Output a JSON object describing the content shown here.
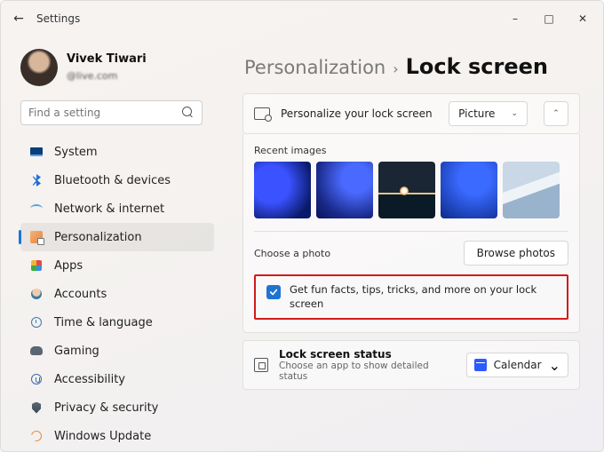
{
  "window": {
    "app_title": "Settings"
  },
  "user": {
    "name": "Vivek Tiwari",
    "email_suffix": "@live.com"
  },
  "search": {
    "placeholder": "Find a setting"
  },
  "nav": [
    {
      "label": "System"
    },
    {
      "label": "Bluetooth & devices"
    },
    {
      "label": "Network & internet"
    },
    {
      "label": "Personalization"
    },
    {
      "label": "Apps"
    },
    {
      "label": "Accounts"
    },
    {
      "label": "Time & language"
    },
    {
      "label": "Gaming"
    },
    {
      "label": "Accessibility"
    },
    {
      "label": "Privacy & security"
    },
    {
      "label": "Windows Update"
    }
  ],
  "breadcrumb": {
    "parent": "Personalization",
    "current": "Lock screen"
  },
  "personalize_row": {
    "icon": "monitor-lock-icon",
    "label": "Personalize your lock screen",
    "select_value": "Picture"
  },
  "recent": {
    "title": "Recent images",
    "count": 5
  },
  "choose": {
    "label": "Choose a photo",
    "button": "Browse photos"
  },
  "checkbox": {
    "label": "Get fun facts, tips, tricks, and more on your lock screen",
    "checked": true
  },
  "status": {
    "title": "Lock screen status",
    "desc": "Choose an app to show detailed status",
    "select_value": "Calendar"
  },
  "colors": {
    "accent": "#1f74d1",
    "highlight_border": "#d11a1a"
  }
}
